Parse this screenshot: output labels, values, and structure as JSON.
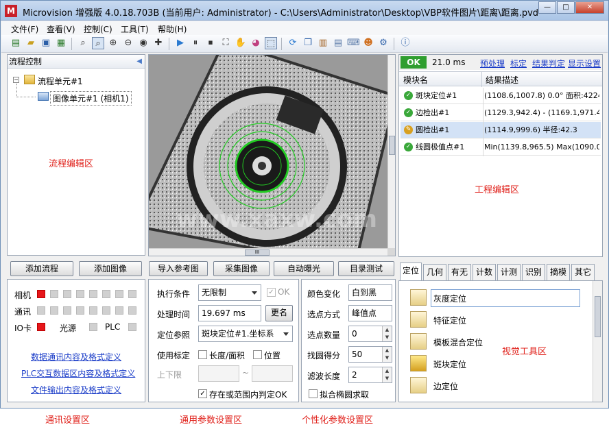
{
  "window": {
    "title": "Microvision 增强版 4.0.18.703B (当前用户: Administrator) - C:\\Users\\Administrator\\Desktop\\VBP软件图片\\距离\\距离.pvd",
    "icon_letter": "M",
    "minimize": "—",
    "maximize": "□",
    "close": "✕"
  },
  "menu": [
    "文件(F)",
    "查看(V)",
    "控制(C)",
    "工具(T)",
    "帮助(H)"
  ],
  "flow_panel": {
    "title": "流程控制",
    "collapse_glyph": "◀",
    "tree_root": "流程单元#1",
    "tree_child": "图像单元#1 (相机1)",
    "region_label": "流程编辑区",
    "add_flow": "添加流程",
    "add_image": "添加图像"
  },
  "image_panel": {
    "watermark": "www.xaxw.com",
    "scroll_thumb": "III",
    "buttons": [
      "导入参考图",
      "采集图像",
      "自动曝光",
      "目录测试"
    ]
  },
  "project_panel": {
    "status": "OK",
    "time": "21.0 ms",
    "links": [
      "预处理",
      "标定",
      "结果判定",
      "显示设置"
    ],
    "col_module": "模块名",
    "col_result": "结果描述",
    "rows": [
      {
        "name": "斑块定位#1",
        "result": "(1108.6,1007.8) 0.0° 面积:4224",
        "selected": false
      },
      {
        "name": "边检出#1",
        "result": "(1129.3,942.4) - (1169.1,971.4)",
        "selected": false
      },
      {
        "name": "圆检出#1",
        "result": "(1114.9,999.6) 半径:42.3",
        "selected": true
      },
      {
        "name": "线圆极值点#1",
        "result": "Min(1139.8,965.5) Max(1090.0,10",
        "selected": false
      }
    ],
    "region_label": "工程编辑区"
  },
  "comm_panel": {
    "camera": "相机",
    "comm": "通讯",
    "io": "IO卡",
    "light": "光源",
    "plc": "PLC",
    "link1": "数据通讯内容及格式定义",
    "link2": "PLC交互数据区内容及格式定义",
    "link3": "文件输出内容及格式定义"
  },
  "params": {
    "exec_cond_label": "执行条件",
    "exec_cond_value": "无限制",
    "ok_label": "OK",
    "proc_time_label": "处理时间",
    "proc_time_value": "19.697 ms",
    "more_button": "更名",
    "locate_ref_label": "定位参照",
    "locate_ref_value": "斑块定位#1.坐标系",
    "calib_label": "使用标定",
    "length_area": "长度/面积",
    "position": "位置",
    "limits_label": "上下限",
    "range_sep": "~",
    "exist_judge": "存在或范围内判定OK"
  },
  "custom": {
    "color_change_label": "颜色变化",
    "color_change_value": "白到黑",
    "point_mode_label": "选点方式",
    "point_mode_value": "峰值点",
    "point_count_label": "选点数量",
    "point_count_value": "0",
    "score_label": "找圆得分",
    "score_value": "50",
    "filter_label": "滤波长度",
    "filter_value": "2",
    "fit_ellipse": "拟合椭圆求取"
  },
  "tools_panel": {
    "tabs": [
      "定位",
      "几何",
      "有无",
      "计数",
      "计测",
      "识别",
      "摘模",
      "其它"
    ],
    "items": [
      "灰度定位",
      "特征定位",
      "模板混合定位",
      "斑块定位",
      "边定位"
    ],
    "region_label": "视觉工具区"
  },
  "bottom_labels": [
    "通讯设置区",
    "通用参数设置区",
    "个性化参数设置区"
  ]
}
